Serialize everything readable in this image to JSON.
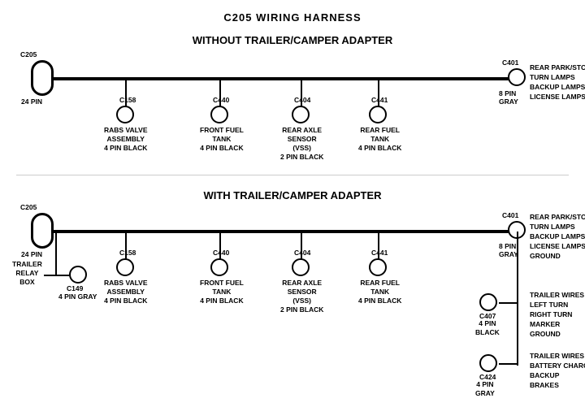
{
  "title": "C205 WIRING HARNESS",
  "section1": {
    "label": "WITHOUT  TRAILER/CAMPER  ADAPTER",
    "left_connector": {
      "id": "C205",
      "pin": "24 PIN"
    },
    "right_connector": {
      "id": "C401",
      "pin": "8 PIN",
      "color": "GRAY",
      "desc": "REAR PARK/STOP\nTURN LAMPS\nBACKUP LAMPS\nLICENSE LAMPS"
    },
    "connectors": [
      {
        "id": "C158",
        "desc": "RABS VALVE\nASSEMBLY\n4 PIN BLACK"
      },
      {
        "id": "C440",
        "desc": "FRONT FUEL\nTANK\n4 PIN BLACK"
      },
      {
        "id": "C404",
        "desc": "REAR AXLE\nSENSOR\n(VSS)\n2 PIN BLACK"
      },
      {
        "id": "C441",
        "desc": "REAR FUEL\nTANK\n4 PIN BLACK"
      }
    ]
  },
  "section2": {
    "label": "WITH  TRAILER/CAMPER  ADAPTER",
    "left_connector": {
      "id": "C205",
      "pin": "24 PIN"
    },
    "right_connector": {
      "id": "C401",
      "pin": "8 PIN",
      "color": "GRAY",
      "desc": "REAR PARK/STOP\nTURN LAMPS\nBACKUP LAMPS\nLICENSE LAMPS\nGROUND"
    },
    "connectors": [
      {
        "id": "C158",
        "desc": "RABS VALVE\nASSEMBLY\n4 PIN BLACK"
      },
      {
        "id": "C440",
        "desc": "FRONT FUEL\nTANK\n4 PIN BLACK"
      },
      {
        "id": "C404",
        "desc": "REAR AXLE\nSENSOR\n(VSS)\n2 PIN BLACK"
      },
      {
        "id": "C441",
        "desc": "REAR FUEL\nTANK\n4 PIN BLACK"
      }
    ],
    "trailer_relay": {
      "label": "TRAILER\nRELAY\nBOX",
      "connector": "C149",
      "pin": "4 PIN GRAY"
    },
    "right_connectors": [
      {
        "id": "C407",
        "pin": "4 PIN\nBLACK",
        "desc": "TRAILER WIRES\nLEFT TURN\nRIGHT TURN\nMARKER\nGROUND"
      },
      {
        "id": "C424",
        "pin": "4 PIN\nGRAY",
        "desc": "TRAILER WIRES\nBATTERY CHARGE\nBACKUP\nBRAKES"
      }
    ]
  }
}
